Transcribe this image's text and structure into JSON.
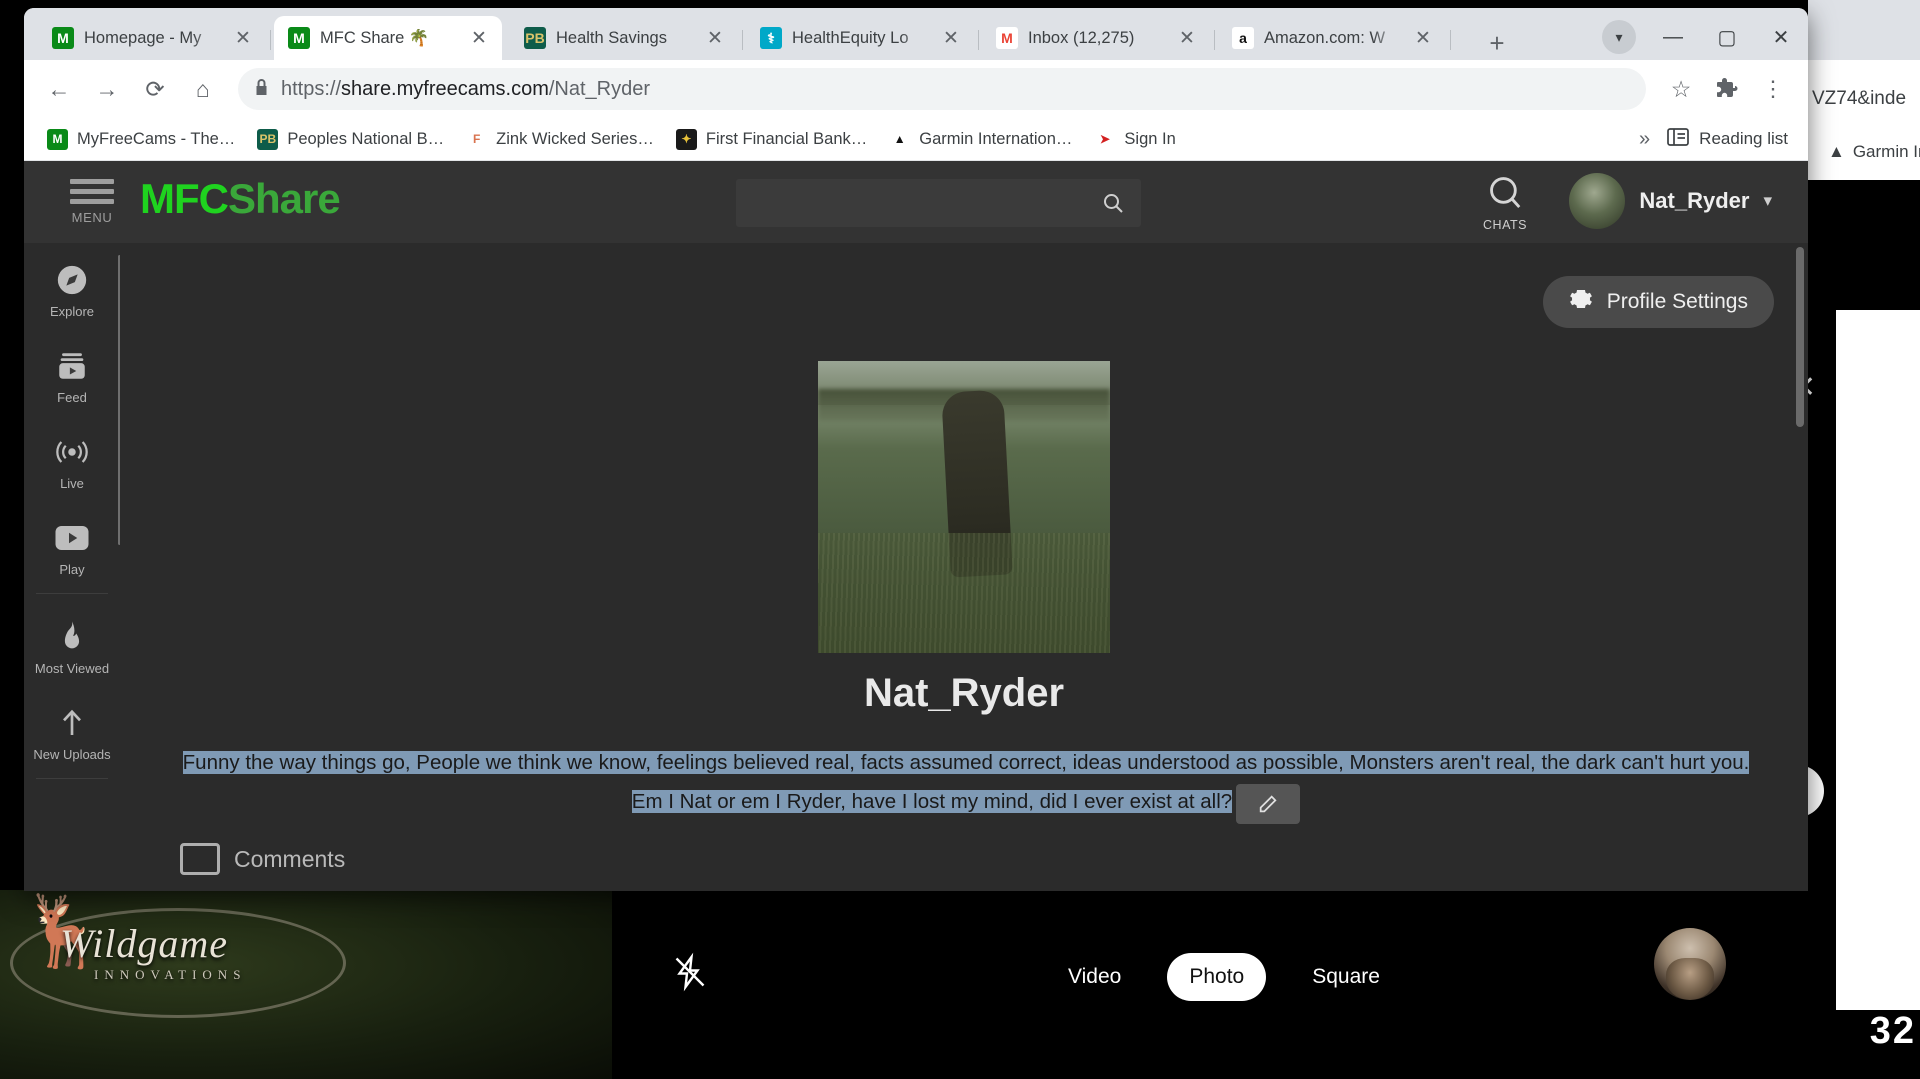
{
  "browser": {
    "tabs": [
      {
        "title": "Homepage - My",
        "favicon": "mfc-favicon",
        "active": false
      },
      {
        "title": "MFC Share 🌴",
        "favicon": "mfc-favicon",
        "active": true
      },
      {
        "title": "Health Savings",
        "favicon": "peoples-bank-favicon",
        "active": false
      },
      {
        "title": "HealthEquity Lo",
        "favicon": "healthequity-favicon",
        "active": false
      },
      {
        "title": "Inbox (12,275)",
        "favicon": "gmail-favicon",
        "active": false
      },
      {
        "title": "Amazon.com: W",
        "favicon": "amazon-favicon",
        "active": false
      }
    ],
    "new_tab_label": "+",
    "window_controls": {
      "profile": "▾",
      "minimize": "—",
      "maximize": "▢",
      "close": "✕"
    },
    "toolbar": {
      "back": "←",
      "forward": "→",
      "reload": "⟳",
      "home": "⌂",
      "lock": "🔒",
      "url_prefix": "https://",
      "url_domain": "share.myfreecams.com",
      "url_path": "/Nat_Ryder",
      "bookmark_star": "☆",
      "extensions": "🧩",
      "menu": "⋮"
    },
    "bookmarks": [
      {
        "label": "MyFreeCams - The…",
        "icon": "mfc-bookmark-icon"
      },
      {
        "label": "Peoples National B…",
        "icon": "peoples-bank-bookmark-icon"
      },
      {
        "label": "Zink Wicked Series…",
        "icon": "zink-bookmark-icon"
      },
      {
        "label": "First Financial Bank…",
        "icon": "first-financial-bookmark-icon"
      },
      {
        "label": "Garmin Internation…",
        "icon": "garmin-bookmark-icon"
      },
      {
        "label": "Sign In",
        "icon": "signin-bookmark-icon"
      }
    ],
    "bookmarks_overflow": "»",
    "reading_list_label": "Reading list",
    "behind_window": {
      "url_fragment": "VZ74&inde",
      "bookmark_fragment": "Garmin In"
    }
  },
  "site": {
    "brand_part1": "MFC",
    "brand_part2": "Share",
    "menu_label": "MENU",
    "search": {
      "value": "",
      "placeholder": ""
    },
    "chats_label": "CHATS",
    "user": {
      "name": "Nat_Ryder",
      "caret": "▾"
    },
    "sidebar": [
      {
        "label": "Explore",
        "icon": "compass-icon"
      },
      {
        "label": "Feed",
        "icon": "feed-icon"
      },
      {
        "label": "Live",
        "icon": "live-broadcast-icon"
      },
      {
        "label": "Play",
        "icon": "play-video-icon"
      },
      {
        "label": "Most Viewed",
        "icon": "flame-icon"
      },
      {
        "label": "New Uploads",
        "icon": "upload-icon"
      }
    ],
    "profile_settings_label": "Profile Settings",
    "profile": {
      "username": "Nat_Ryder",
      "bio": "Funny the way things go, People we think we know, feelings believed real, facts assumed correct, ideas understood as possible, Monsters aren't real, the dark can't hurt you. Em I Nat or em I Ryder, have I lost my mind, did I ever exist at all?",
      "edit_icon": "pencil-icon",
      "comments_label": "Comments"
    }
  },
  "background": {
    "camera_overlay": {
      "modes": [
        "Video",
        "Photo",
        "Square"
      ],
      "active_mode": "Photo",
      "flash_icon": "flash-off-icon",
      "avatar": "user-avatar"
    },
    "logo_title": "Wildgame",
    "logo_sub": "INNOVATIONS",
    "right_number": "32",
    "close_icon": "✕"
  },
  "colors": {
    "brand_green": "#1fd31f",
    "page_bg": "#2b2b2b",
    "header_bg": "#333333",
    "selection_blue": "#7f9ab5",
    "chrome_tabstrip": "#dee1e6"
  }
}
